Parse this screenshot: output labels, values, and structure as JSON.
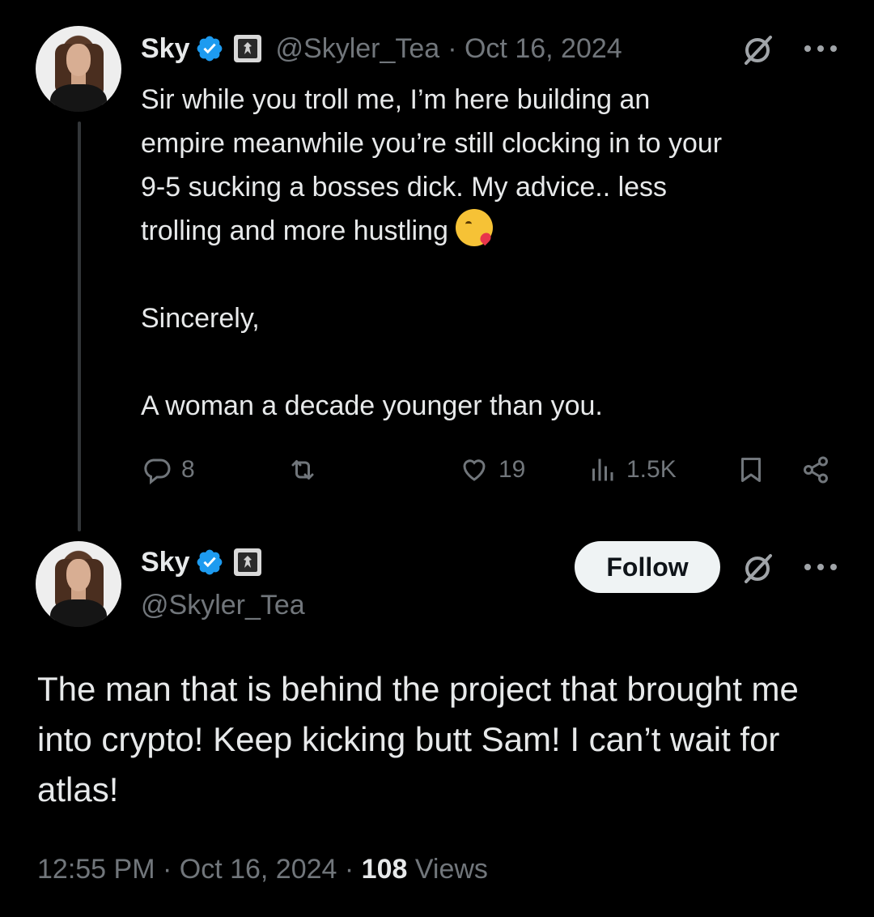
{
  "reply_tweet": {
    "name": "Sky",
    "handle": "@Skyler_Tea",
    "date": "· Oct 16, 2024",
    "text": "Sir while you troll me, I’m here building an\nempire meanwhile you’re still clocking in to your\n9-5 sucking a bosses dick. My advice.. less\ntrolling and more hustling",
    "text_after_emoji": "\n\nSincerely,\n\nA woman a decade younger than you.",
    "emoji": "face-blowing-a-kiss",
    "actions": {
      "replies": "8",
      "reposts": "",
      "likes": "19",
      "views": "1.5K"
    }
  },
  "main_tweet": {
    "name": "Sky",
    "handle": "@Skyler_Tea",
    "follow_label": "Follow",
    "text": "The man that is behind the project that brought me into crypto! Keep kicking butt Sam! I can’t wait for atlas!",
    "time": "12:55 PM · Oct 16, 2024 · ",
    "views_count": "108",
    "views_label": " Views"
  },
  "colors": {
    "background": "#000000",
    "text": "#e7e9ea",
    "secondary": "#71767b",
    "verified": "#1d9bf0"
  }
}
